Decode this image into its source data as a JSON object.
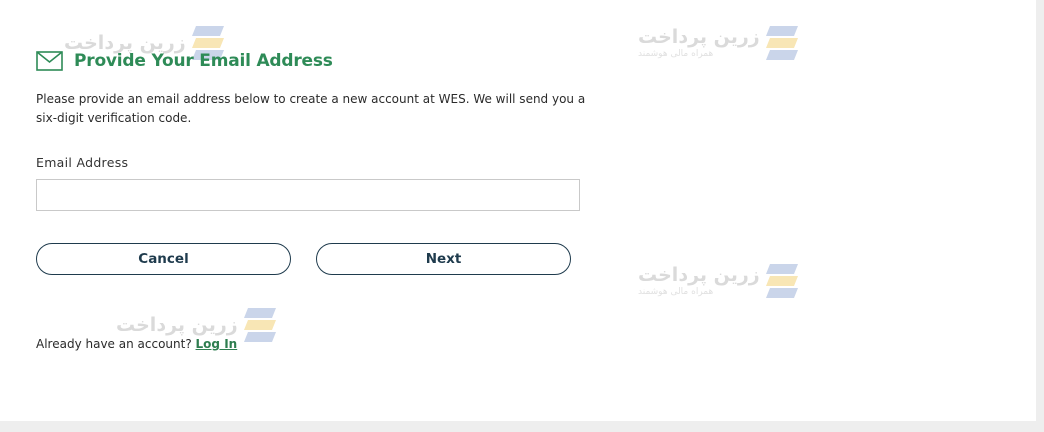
{
  "watermark": {
    "title": "زرین پرداخت",
    "subtitle": "همراه مالی هوشمند",
    "logo_icon": "zarinpal-logo-icon"
  },
  "form": {
    "mail_icon": "envelope-icon",
    "heading": "Provide Your Email Address",
    "intro": "Please provide an email address below to create a new account at WES. We will send you a six-digit verification code.",
    "email_label": "Email Address",
    "email_value": "",
    "email_placeholder": "",
    "cancel_label": "Cancel",
    "next_label": "Next",
    "login_prompt": "Already have an account?",
    "login_link": "Log In"
  },
  "colors": {
    "heading_green": "#2e8b57",
    "button_border": "#1f3b4d",
    "link_green": "#2e7d4f",
    "page_background": "#eeeeee"
  }
}
